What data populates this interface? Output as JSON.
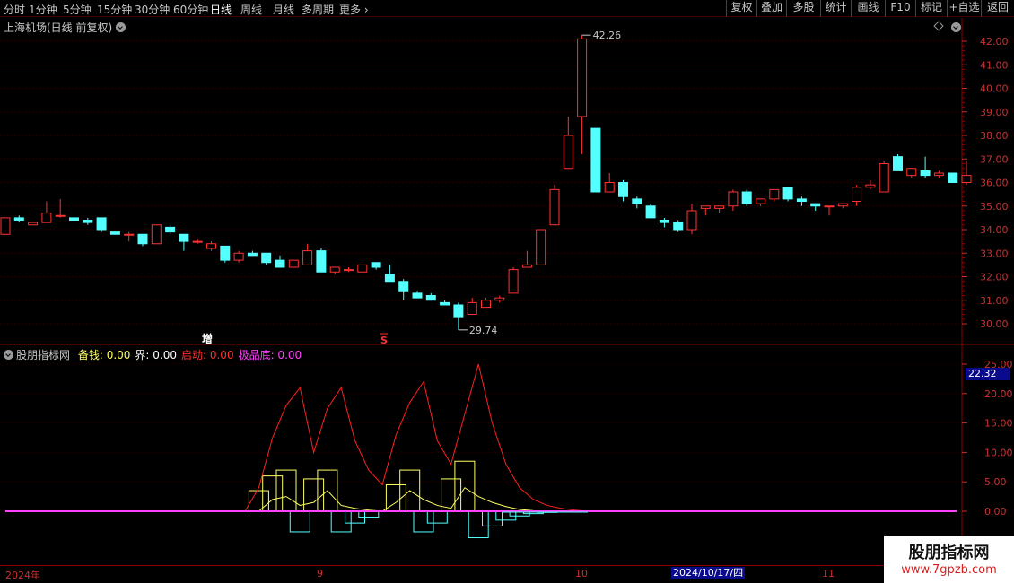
{
  "toolbar": {
    "periods": [
      "分时",
      "1分钟",
      "5分钟",
      "15分钟",
      "30分钟",
      "60分钟",
      "日线",
      "周线",
      "月线",
      "多周期",
      "更多"
    ],
    "active_period": "日线",
    "right_buttons": [
      "复权",
      "叠加",
      "多股",
      "统计",
      "画线",
      "F10",
      "标记",
      "+自选",
      "返回"
    ]
  },
  "main_chart": {
    "title": "上海机场(日线 前复权)",
    "high_label": "42.26",
    "low_label": "29.74",
    "y_ticks": [
      "42.00",
      "41.00",
      "40.00",
      "39.00",
      "38.00",
      "37.00",
      "36.00",
      "35.00",
      "34.00",
      "33.00",
      "32.00",
      "31.00",
      "30.00"
    ],
    "markers": [
      {
        "text": "增",
        "color": "#ffffff"
      },
      {
        "text": "S",
        "color": "#ff3030"
      }
    ]
  },
  "indicator": {
    "name": "股朋指标网",
    "fields": [
      {
        "label": "备钱:",
        "value": "0.00",
        "color": "#ffff64"
      },
      {
        "label": "界:",
        "value": "0.00",
        "color": "#ffffff"
      },
      {
        "label": "启动:",
        "value": "0.00",
        "color": "#ff3030"
      },
      {
        "label": "极品底:",
        "value": "0.00",
        "color": "#ff40ff"
      }
    ],
    "y_ticks": [
      "25.00",
      "20.00",
      "15.00",
      "10.00",
      "5.00",
      "0.00"
    ],
    "current_value": "22.32"
  },
  "date_axis": {
    "labels": [
      "2024年",
      "9",
      "10",
      "11"
    ],
    "cursor_date": "2024/10/17/四"
  },
  "watermark": {
    "line1": "股朋指标网",
    "line2": "www.7gpzb.com"
  },
  "chart_data": [
    {
      "type": "candlestick",
      "title": "上海机场(日线 前复权)",
      "ylim": [
        29.5,
        42.5
      ],
      "candles": [
        {
          "o": 33.8,
          "h": 34.5,
          "l": 33.8,
          "c": 34.5
        },
        {
          "o": 34.5,
          "h": 34.6,
          "l": 34.3,
          "c": 34.4
        },
        {
          "o": 34.2,
          "h": 34.3,
          "l": 34.2,
          "c": 34.3
        },
        {
          "o": 34.3,
          "h": 35.2,
          "l": 34.3,
          "c": 34.7
        },
        {
          "o": 34.6,
          "h": 35.3,
          "l": 34.5,
          "c": 34.6
        },
        {
          "o": 34.5,
          "h": 34.5,
          "l": 34.4,
          "c": 34.4
        },
        {
          "o": 34.4,
          "h": 34.5,
          "l": 34.2,
          "c": 34.3
        },
        {
          "o": 34.5,
          "h": 34.5,
          "l": 33.9,
          "c": 34.0
        },
        {
          "o": 33.9,
          "h": 33.9,
          "l": 33.8,
          "c": 33.8
        },
        {
          "o": 33.8,
          "h": 33.9,
          "l": 33.5,
          "c": 33.8
        },
        {
          "o": 33.8,
          "h": 33.8,
          "l": 33.3,
          "c": 33.4
        },
        {
          "o": 33.4,
          "h": 34.2,
          "l": 33.4,
          "c": 34.2
        },
        {
          "o": 34.1,
          "h": 34.2,
          "l": 33.8,
          "c": 33.9
        },
        {
          "o": 33.8,
          "h": 33.8,
          "l": 33.1,
          "c": 33.5
        },
        {
          "o": 33.5,
          "h": 33.6,
          "l": 33.4,
          "c": 33.5
        },
        {
          "o": 33.2,
          "h": 33.5,
          "l": 33.1,
          "c": 33.4
        },
        {
          "o": 33.3,
          "h": 33.3,
          "l": 32.6,
          "c": 32.7
        },
        {
          "o": 32.7,
          "h": 33.1,
          "l": 32.6,
          "c": 33.0
        },
        {
          "o": 33.0,
          "h": 33.1,
          "l": 32.9,
          "c": 32.9
        },
        {
          "o": 33.0,
          "h": 33.0,
          "l": 32.5,
          "c": 32.6
        },
        {
          "o": 32.7,
          "h": 32.9,
          "l": 32.4,
          "c": 32.4
        },
        {
          "o": 32.4,
          "h": 32.7,
          "l": 32.4,
          "c": 32.7
        },
        {
          "o": 32.5,
          "h": 33.4,
          "l": 32.5,
          "c": 33.1
        },
        {
          "o": 33.1,
          "h": 33.2,
          "l": 32.2,
          "c": 32.2
        },
        {
          "o": 32.2,
          "h": 32.4,
          "l": 32.1,
          "c": 32.4
        },
        {
          "o": 32.3,
          "h": 32.4,
          "l": 32.2,
          "c": 32.3
        },
        {
          "o": 32.2,
          "h": 32.5,
          "l": 32.2,
          "c": 32.5
        },
        {
          "o": 32.6,
          "h": 32.6,
          "l": 32.3,
          "c": 32.4
        },
        {
          "o": 32.1,
          "h": 32.5,
          "l": 31.8,
          "c": 31.8
        },
        {
          "o": 31.8,
          "h": 31.9,
          "l": 31.0,
          "c": 31.4
        },
        {
          "o": 31.3,
          "h": 31.4,
          "l": 31.1,
          "c": 31.1
        },
        {
          "o": 31.2,
          "h": 31.3,
          "l": 31.0,
          "c": 31.0
        },
        {
          "o": 30.9,
          "h": 31.0,
          "l": 30.8,
          "c": 30.8
        },
        {
          "o": 30.8,
          "h": 30.9,
          "l": 29.74,
          "c": 30.3
        },
        {
          "o": 30.4,
          "h": 31.1,
          "l": 30.4,
          "c": 30.9
        },
        {
          "o": 30.7,
          "h": 31.1,
          "l": 30.7,
          "c": 31.0
        },
        {
          "o": 31.0,
          "h": 31.2,
          "l": 30.9,
          "c": 31.1
        },
        {
          "o": 31.3,
          "h": 32.4,
          "l": 31.3,
          "c": 32.3
        },
        {
          "o": 32.4,
          "h": 33.1,
          "l": 32.4,
          "c": 32.5
        },
        {
          "o": 32.5,
          "h": 34.0,
          "l": 32.5,
          "c": 34.0
        },
        {
          "o": 34.2,
          "h": 35.9,
          "l": 34.2,
          "c": 35.7
        },
        {
          "o": 36.6,
          "h": 38.8,
          "l": 36.6,
          "c": 38.0
        },
        {
          "o": 38.8,
          "h": 42.26,
          "l": 37.2,
          "c": 42.1
        },
        {
          "o": 38.3,
          "h": 38.3,
          "l": 35.6,
          "c": 35.6
        },
        {
          "o": 35.6,
          "h": 36.4,
          "l": 35.6,
          "c": 36.0
        },
        {
          "o": 36.0,
          "h": 36.1,
          "l": 35.2,
          "c": 35.4
        },
        {
          "o": 35.3,
          "h": 35.4,
          "l": 34.9,
          "c": 35.1
        },
        {
          "o": 35.0,
          "h": 35.1,
          "l": 34.5,
          "c": 34.5
        },
        {
          "o": 34.4,
          "h": 34.5,
          "l": 34.1,
          "c": 34.3
        },
        {
          "o": 34.3,
          "h": 34.4,
          "l": 33.9,
          "c": 34.0
        },
        {
          "o": 34.0,
          "h": 35.1,
          "l": 33.8,
          "c": 34.8
        },
        {
          "o": 34.9,
          "h": 35.0,
          "l": 34.6,
          "c": 35.0
        },
        {
          "o": 34.9,
          "h": 35.0,
          "l": 34.7,
          "c": 35.0
        },
        {
          "o": 35.0,
          "h": 35.7,
          "l": 34.8,
          "c": 35.6
        },
        {
          "o": 35.6,
          "h": 35.7,
          "l": 35.0,
          "c": 35.1
        },
        {
          "o": 35.1,
          "h": 35.3,
          "l": 35.0,
          "c": 35.3
        },
        {
          "o": 35.3,
          "h": 35.7,
          "l": 35.2,
          "c": 35.7
        },
        {
          "o": 35.8,
          "h": 35.8,
          "l": 35.2,
          "c": 35.3
        },
        {
          "o": 35.3,
          "h": 35.4,
          "l": 35.0,
          "c": 35.2
        },
        {
          "o": 35.1,
          "h": 35.1,
          "l": 34.8,
          "c": 35.0
        },
        {
          "o": 35.0,
          "h": 35.0,
          "l": 34.6,
          "c": 35.0
        },
        {
          "o": 35.0,
          "h": 35.1,
          "l": 34.9,
          "c": 35.1
        },
        {
          "o": 35.2,
          "h": 35.9,
          "l": 35.0,
          "c": 35.8
        },
        {
          "o": 35.8,
          "h": 36.1,
          "l": 35.7,
          "c": 35.9
        },
        {
          "o": 35.6,
          "h": 36.9,
          "l": 35.6,
          "c": 36.8
        },
        {
          "o": 37.1,
          "h": 37.2,
          "l": 36.5,
          "c": 36.5
        },
        {
          "o": 36.3,
          "h": 36.6,
          "l": 36.2,
          "c": 36.6
        },
        {
          "o": 36.5,
          "h": 37.1,
          "l": 36.2,
          "c": 36.3
        },
        {
          "o": 36.3,
          "h": 36.5,
          "l": 36.2,
          "c": 36.4
        },
        {
          "o": 36.4,
          "h": 36.4,
          "l": 36.0,
          "c": 36.0
        },
        {
          "o": 36.0,
          "h": 36.9,
          "l": 35.9,
          "c": 36.3
        }
      ]
    },
    {
      "type": "line",
      "title": "股朋指标网",
      "ylim": [
        -3,
        26
      ],
      "series": [
        {
          "name": "启动",
          "color": "#ff2020",
          "values": [
            0,
            0,
            0,
            0,
            0,
            0,
            0,
            0,
            0,
            0,
            0,
            0,
            0,
            0,
            0,
            0,
            0,
            0,
            0,
            0,
            0,
            0,
            0,
            0,
            0,
            0,
            0,
            0,
            0,
            0,
            0,
            0,
            0,
            0,
            0,
            0,
            0,
            0,
            0,
            0,
            0,
            0,
            0,
            0,
            0,
            0,
            0,
            0,
            0,
            0,
            0,
            0,
            0,
            0,
            0,
            0,
            0,
            0,
            0,
            0,
            0,
            0,
            0,
            0,
            0,
            0,
            0,
            0,
            0,
            0
          ]
        },
        {
          "name": "备钱",
          "color": "#ffff64",
          "values": [
            0,
            0,
            0,
            0,
            0,
            0,
            0,
            0,
            0,
            0,
            0,
            0,
            0,
            0,
            0,
            0,
            0,
            0,
            0,
            0,
            0,
            0,
            0,
            0,
            0,
            0,
            0,
            0,
            0,
            0,
            0,
            0,
            0,
            0,
            0,
            0,
            0,
            0,
            0,
            0,
            0,
            0,
            0,
            0,
            0,
            0,
            0,
            0,
            0,
            0,
            0,
            0,
            0,
            0,
            0,
            0,
            0,
            0,
            0,
            0,
            0,
            0,
            0,
            0,
            0,
            0,
            0,
            0,
            0,
            0
          ]
        },
        {
          "name": "极品底",
          "color": "#ff40ff",
          "values": [
            0,
            0,
            0,
            0,
            0,
            0,
            0,
            0,
            0,
            0,
            0,
            0,
            0,
            0,
            0,
            0,
            0,
            0,
            0,
            0,
            0,
            0,
            0,
            0,
            0,
            0,
            0,
            0,
            0,
            0,
            0,
            0,
            0,
            0,
            0,
            0,
            0,
            0,
            0,
            0,
            0,
            0,
            0,
            0,
            0,
            0,
            0,
            0,
            0,
            0,
            0,
            0,
            0,
            0,
            0,
            0,
            0,
            0,
            0,
            0,
            0,
            0,
            0,
            0,
            0,
            0,
            0,
            0,
            0,
            0
          ]
        }
      ],
      "red_line": [
        0,
        0,
        0,
        0,
        0,
        0,
        0,
        0,
        0,
        0,
        0,
        0,
        0,
        0,
        0,
        0,
        0,
        0,
        4.0,
        12.5,
        18.0,
        21.0,
        10.0,
        17.5,
        21.0,
        12.0,
        7.0,
        4.5,
        13.0,
        18.5,
        22.0,
        12.0,
        8.0,
        16.5,
        25.0,
        15.0,
        8.0,
        4.0,
        2.0,
        1.0,
        0.5,
        0.2,
        0,
        0,
        0,
        0,
        0,
        0,
        0,
        0,
        0,
        0,
        0,
        0,
        0,
        0,
        0,
        0,
        0,
        0,
        0,
        0,
        0,
        0,
        0,
        0,
        0,
        0,
        0,
        0
      ],
      "yellow_bars": [
        0,
        0,
        0,
        0,
        0,
        0,
        0,
        0,
        0,
        0,
        0,
        0,
        0,
        0,
        0,
        0,
        0,
        0,
        3.5,
        6.0,
        7.0,
        0,
        5.5,
        7.0,
        0,
        0,
        0,
        0,
        4.5,
        7.0,
        0,
        0,
        5.5,
        8.5,
        0,
        0,
        0,
        0,
        0,
        0,
        0,
        0,
        0,
        0,
        0,
        0,
        0,
        0,
        0,
        0,
        0,
        0,
        0,
        0,
        0,
        0,
        0,
        0,
        0,
        0,
        0,
        0,
        0,
        0,
        0,
        0,
        0,
        0,
        0,
        0
      ],
      "yellow_line": [
        0,
        0,
        0,
        0,
        0,
        0,
        0,
        0,
        0,
        0,
        0,
        0,
        0,
        0,
        0,
        0,
        0,
        0,
        0,
        2.0,
        2.5,
        1.0,
        1.5,
        3.5,
        1.0,
        0.5,
        0.2,
        0,
        1.5,
        3.5,
        2.0,
        1.0,
        0.5,
        4.0,
        2.5,
        1.5,
        0.8,
        0.3,
        0.1,
        0,
        0,
        0,
        0,
        0,
        0,
        0,
        0,
        0,
        0,
        0,
        0,
        0,
        0,
        0,
        0,
        0,
        0,
        0,
        0,
        0,
        0,
        0,
        0,
        0,
        0,
        0,
        0,
        0,
        0,
        0
      ],
      "cyan_bars": [
        0,
        0,
        0,
        0,
        0,
        0,
        0,
        0,
        0,
        0,
        0,
        0,
        0,
        0,
        0,
        0,
        0,
        0,
        0,
        0,
        0,
        -3.5,
        0,
        0,
        -3.5,
        -2.0,
        -1.0,
        0,
        0,
        0,
        -3.5,
        -2.0,
        0,
        0,
        -4.5,
        -2.5,
        -1.5,
        -0.8,
        -0.4,
        -0.2,
        -0.1,
        0,
        0,
        0,
        0,
        0,
        0,
        0,
        0,
        0,
        0,
        0,
        0,
        0,
        0,
        0,
        0,
        0,
        0,
        0,
        0,
        0,
        0,
        0,
        0,
        0,
        0,
        0,
        0,
        0
      ]
    }
  ]
}
